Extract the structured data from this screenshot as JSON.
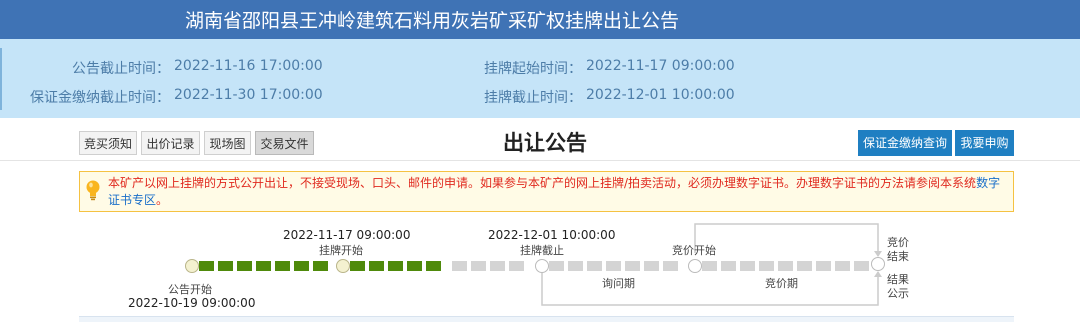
{
  "header": {
    "title": "湖南省邵阳县王冲岭建筑石料用灰岩矿采矿权挂牌出让公告"
  },
  "info": {
    "announce_end_label": "公告截止时间：",
    "announce_end_value": "2022-11-16 17:00:00",
    "listing_start_label": "挂牌起始时间：",
    "listing_start_value": "2022-11-17 09:00:00",
    "deposit_end_label": "保证金缴纳截止时间：",
    "deposit_end_value": "2022-11-30 17:00:00",
    "listing_end_label": "挂牌截止时间：",
    "listing_end_value": "2022-12-01 10:00:00"
  },
  "tabs": [
    {
      "label": "竞买须知",
      "active": false
    },
    {
      "label": "出价记录",
      "active": false
    },
    {
      "label": "现场图",
      "active": false
    },
    {
      "label": "交易文件",
      "active": true
    }
  ],
  "page_title": "出让公告",
  "actions": {
    "deposit_query": "保证金缴纳查询",
    "apply": "我要申购"
  },
  "notice": {
    "icon": "lightbulb-icon",
    "text": "本矿产以网上挂牌的方式公开出让，不接受现场、口头、邮件的申请。如果参与本矿产的网上挂牌/拍卖活动，必须办理数字证书。办理数字证书的方法请参阅本系统",
    "link": "数字证书专区",
    "suffix": "。"
  },
  "timeline": {
    "announce_start_label": "公告开始",
    "announce_start_date": "2022-10-19 09:00:00",
    "listing_start_label": "挂牌开始",
    "listing_start_date": "2022-11-17 09:00:00",
    "listing_end_label": "挂牌截止",
    "listing_end_date": "2022-12-01 10:00:00",
    "bidding_start_label": "竞价开始",
    "inquiry_period_label": "询问期",
    "bidding_period_label": "竞价期",
    "bidding_end_label_1": "竞价",
    "bidding_end_label_2": "结束",
    "result_label_1": "结果",
    "result_label_2": "公示"
  },
  "colors": {
    "header_bg": "#3f73b5",
    "info_bg": "#c5e4f8",
    "done_segment": "#4f8a0b",
    "pending_segment": "#d4d4d4",
    "notice_text": "#e02a1f",
    "button_blue": "#1f7fc2"
  }
}
